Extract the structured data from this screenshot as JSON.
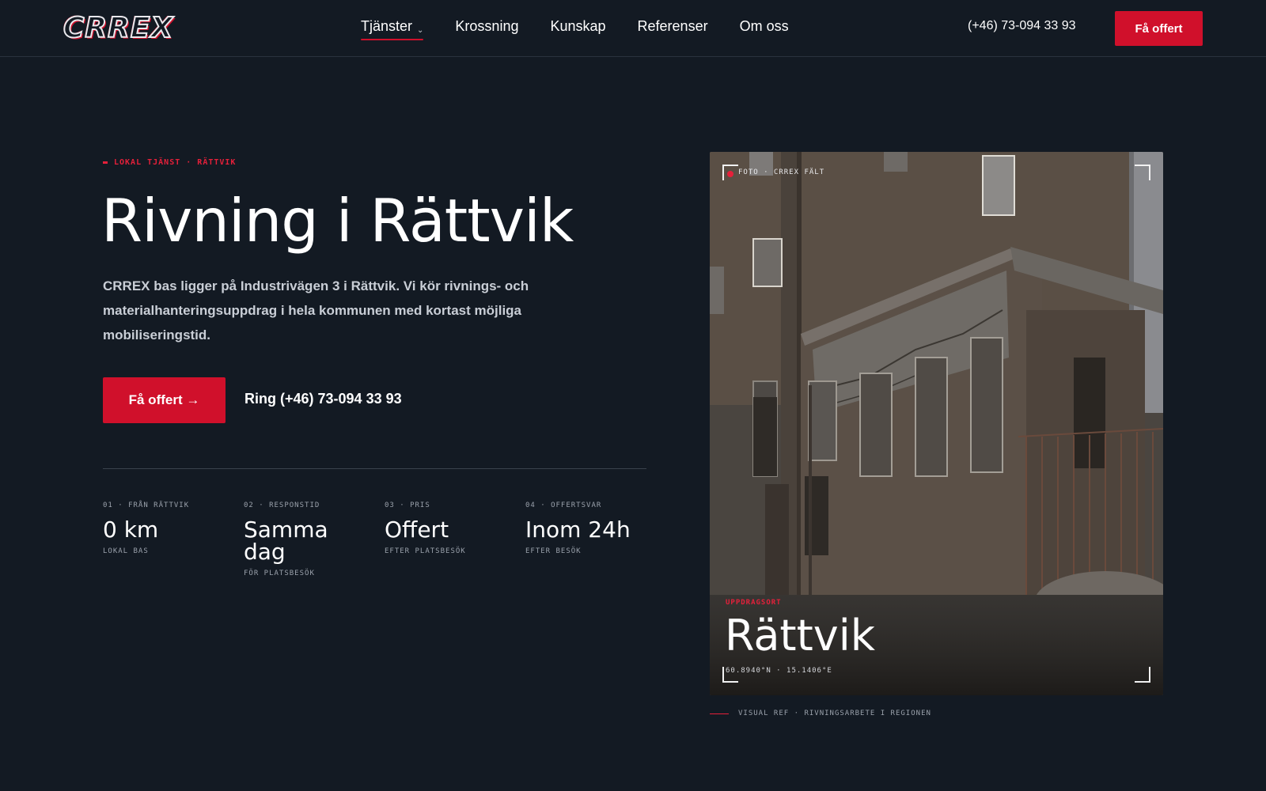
{
  "header": {
    "logo": "CRREX",
    "nav": [
      {
        "label": "Tjänster",
        "has_dropdown": true,
        "active": true
      },
      {
        "label": "Krossning"
      },
      {
        "label": "Kunskap"
      },
      {
        "label": "Referenser"
      },
      {
        "label": "Om oss"
      }
    ],
    "phone": "(+46) 73-094 33 93",
    "cta_label": "Få offert"
  },
  "hero": {
    "eyebrow": "LOKAL TJÄNST · RÄTTVIK",
    "title": "Rivning i Rättvik",
    "lead": "CRREX bas ligger på Industrivägen 3 i Rättvik. Vi kör rivnings- och materialhanteringsuppdrag i hela kommunen med kortast möjliga mobiliseringstid.",
    "cta_label": "Få offert →",
    "call_label": "Ring (+46) 73-094 33 93",
    "stats": [
      {
        "label": "01 · FRÅN RÄTTVIK",
        "value": "0 km",
        "sub": "LOKAL BAS"
      },
      {
        "label": "02 · RESPONSTID",
        "value": "Samma dag",
        "sub": "FÖR PLATSBESÖK"
      },
      {
        "label": "03 · PRIS",
        "value": "Offert",
        "sub": "EFTER PLATSBESÖK"
      },
      {
        "label": "04 · OFFERTSVAR",
        "value": "Inom 24h",
        "sub": "EFTER BESÖK"
      }
    ]
  },
  "photo": {
    "tag": "FOTO · CRREX FÄLT",
    "kicker": "UPPDRAGSORT",
    "place": "Rättvik",
    "coords": "60.8940°N · 15.1406°E",
    "caption": "VISUAL REF · RIVNINGSARBETE I REGIONEN"
  },
  "colors": {
    "background": "#131a23",
    "accent": "#d0102b",
    "text": "#ffffff",
    "muted": "#9aa1ab"
  }
}
